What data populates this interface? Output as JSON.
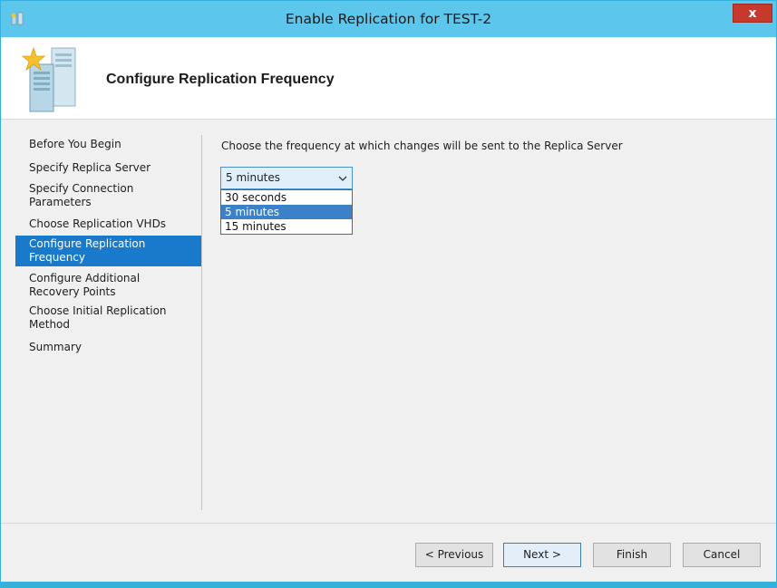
{
  "window": {
    "title": "Enable Replication for TEST-2",
    "close_label": "x"
  },
  "header": {
    "title": "Configure Replication Frequency"
  },
  "sidebar": {
    "items": [
      {
        "label": "Before You Begin"
      },
      {
        "label": "Specify Replica Server"
      },
      {
        "label": "Specify Connection\nParameters"
      },
      {
        "label": "Choose Replication VHDs"
      },
      {
        "label": "Configure Replication\nFrequency",
        "active": true
      },
      {
        "label": "Configure Additional\nRecovery Points"
      },
      {
        "label": "Choose Initial Replication\nMethod"
      },
      {
        "label": "Summary"
      }
    ]
  },
  "main": {
    "instruction": "Choose the frequency at which changes will be sent to the Replica Server",
    "frequency_select": {
      "value": "5 minutes",
      "options": [
        "30 seconds",
        "5 minutes",
        "15 minutes"
      ],
      "highlighted": "5 minutes"
    }
  },
  "buttons": {
    "previous": "< Previous",
    "next": "Next >",
    "finish": "Finish",
    "cancel": "Cancel"
  },
  "colors": {
    "titlebar": "#5cc6ec",
    "active_nav": "#1979ca",
    "close_button": "#c7382d"
  }
}
